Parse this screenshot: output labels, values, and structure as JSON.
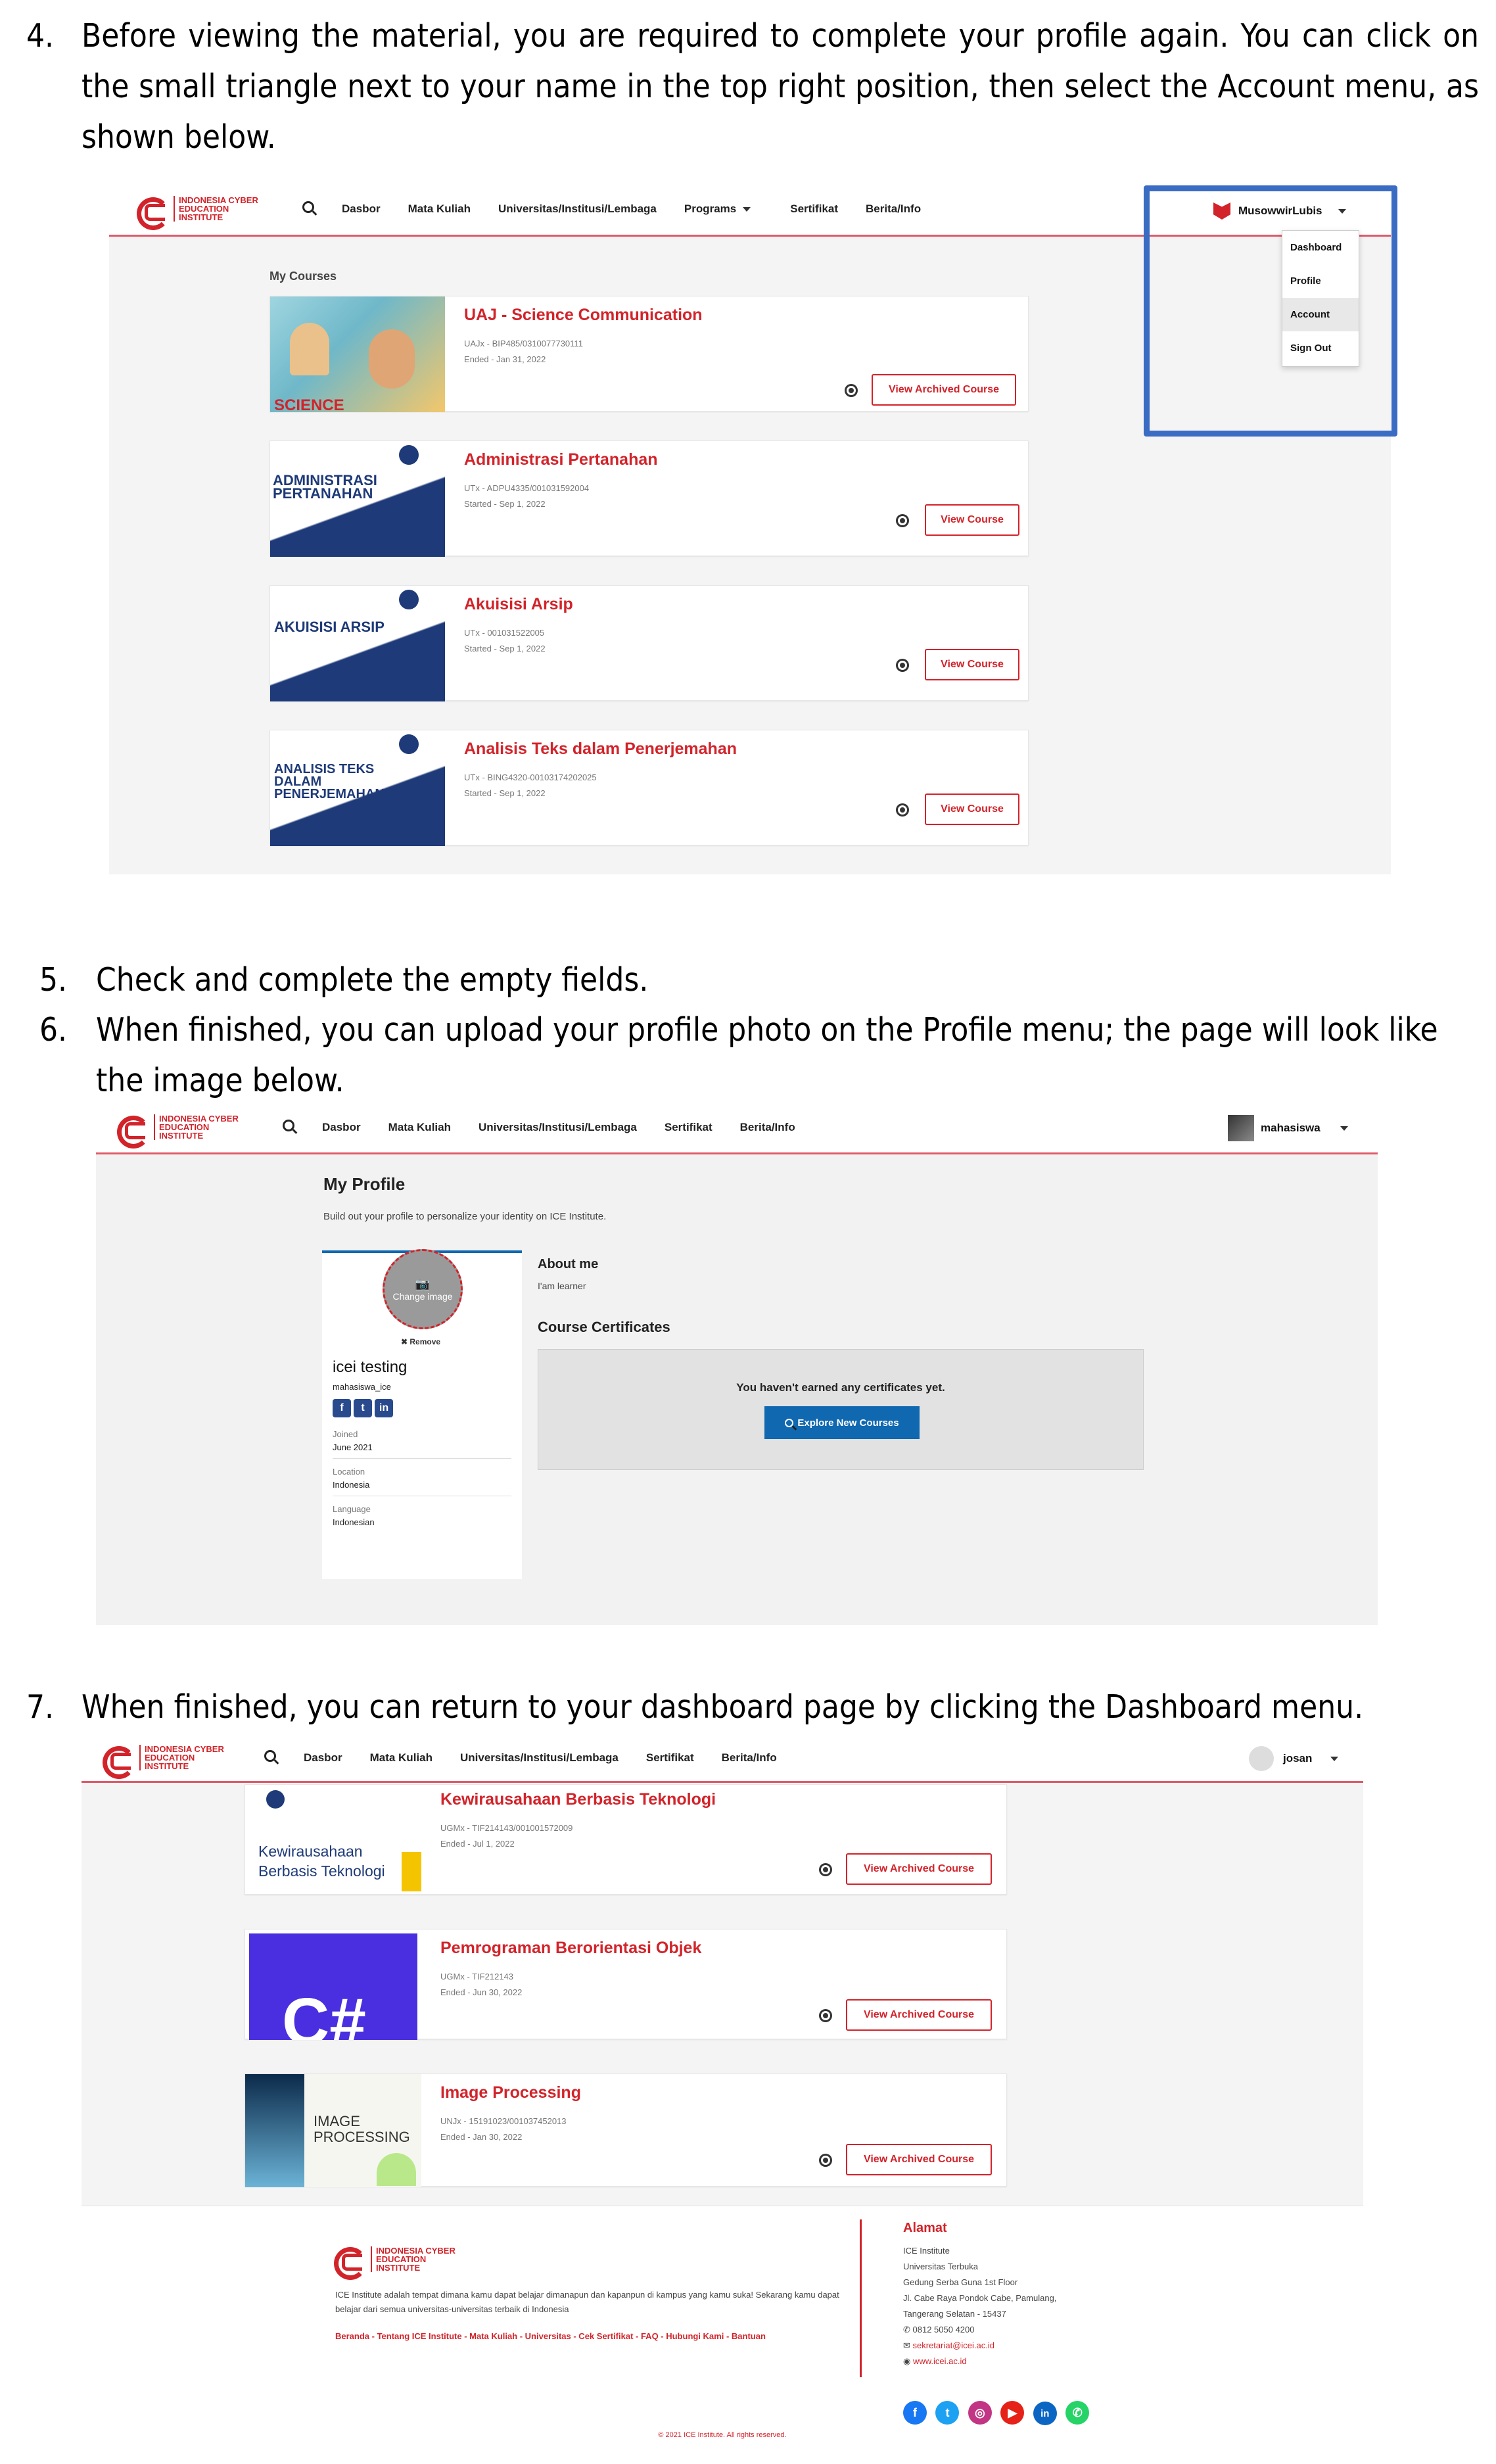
{
  "steps": {
    "s4": {
      "num": "4.",
      "text": "Before viewing the material, you are required to complete your profile again. You can click on the small triangle next to your name in the top right position, then select the Account menu, as shown below."
    },
    "s5": {
      "num": "5.",
      "text": "Check and complete the empty fields."
    },
    "s6": {
      "num": "6.",
      "text": "When finished, you can upload your profile photo on the Profile menu; the page will look like the image below."
    },
    "s7": {
      "num": "7.",
      "text": "When finished, you can return to your dashboard page by clicking the Dashboard menu."
    }
  },
  "brand": {
    "logo_text": "INDONESIA CYBER EDUCATION INSTITUTE",
    "accent": "#d2232a",
    "highlight": "#3b6cc4"
  },
  "shot1": {
    "nav": [
      "Dasbor",
      "Mata Kuliah",
      "Universitas/Institusi/Lembaga",
      "Programs",
      "Sertifikat",
      "Berita/Info"
    ],
    "user": "MusowwirLubis",
    "menu": [
      "Dashboard",
      "Profile",
      "Account",
      "Sign Out"
    ],
    "section_title": "My Courses",
    "courses": [
      {
        "title": "UAJ - Science Communication",
        "code": "UAJx - BIP485/0310077730111",
        "date": "Ended - Jan 31, 2022",
        "button": "View Archived Course",
        "thumb_text": "SCIENCE"
      },
      {
        "title": "Administrasi Pertanahan",
        "code": "UTx - ADPU4335/001031592004",
        "date": "Started - Sep 1, 2022",
        "button": "View Course",
        "thumb_text": "ADMINISTRASI PERTANAHAN"
      },
      {
        "title": "Akuisisi Arsip",
        "code": "UTx - 001031522005",
        "date": "Started - Sep 1, 2022",
        "button": "View Course",
        "thumb_text": "AKUISISI ARSIP"
      },
      {
        "title": "Analisis Teks dalam Penerjemahan",
        "code": "UTx - BING4320-00103174202025",
        "date": "Started - Sep 1, 2022",
        "button": "View Course",
        "thumb_text": "ANALISIS TEKS DALAM PENERJEMAHAN"
      }
    ]
  },
  "shot2": {
    "nav": [
      "Dasbor",
      "Mata Kuliah",
      "Universitas/Institusi/Lembaga",
      "Sertifikat",
      "Berita/Info"
    ],
    "user": "mahasiswa",
    "page_title": "My Profile",
    "subtitle": "Build out your profile to personalize your identity on ICE Institute.",
    "change_image": "Change image",
    "remove": "✖ Remove",
    "full_name": "icei testing",
    "username": "mahasiswa_ice",
    "joined_label": "Joined",
    "joined_value": "June 2021",
    "location_label": "Location",
    "location_value": "Indonesia",
    "language_label": "Language",
    "language_value": "Indonesian",
    "about_heading": "About me",
    "about_text": "I'am learner",
    "certs_heading": "Course Certificates",
    "no_certs": "You haven't earned any certificates yet.",
    "explore_button": "Explore New Courses"
  },
  "shot3": {
    "nav": [
      "Dasbor",
      "Mata Kuliah",
      "Universitas/Institusi/Lembaga",
      "Sertifikat",
      "Berita/Info"
    ],
    "user": "josan",
    "courses": [
      {
        "title": "Kewirausahaan Berbasis Teknologi",
        "code": "UGMx - TIF214143/001001572009",
        "date": "Ended - Jul 1, 2022",
        "button": "View Archived Course",
        "thumb_text": "Kewirausahaan Berbasis Teknologi"
      },
      {
        "title": "Pemrograman Berorientasi Objek",
        "code": "UGMx - TIF212143",
        "date": "Ended - Jun 30, 2022",
        "button": "View Archived Course",
        "thumb_text": "C#"
      },
      {
        "title": "Image Processing",
        "code": "UNJx - 15191023/001037452013",
        "date": "Ended - Jan 30, 2022",
        "button": "View Archived Course",
        "thumb_text": "IMAGE PROCESSING"
      }
    ],
    "footer": {
      "about": "ICE Institute adalah tempat dimana kamu dapat belajar dimanapun dan kapanpun di kampus yang kamu suka! Sekarang kamu dapat belajar dari semua universitas-universitas terbaik di Indonesia",
      "links": "Beranda - Tentang ICE Institute - Mata Kuliah - Universitas - Cek Sertifikat - FAQ - Hubungi Kami - Bantuan",
      "address_heading": "Alamat",
      "address_lines": [
        "ICE Institute",
        "Universitas Terbuka",
        "Gedung Serba Guna 1st Floor",
        "Jl. Cabe Raya Pondok Cabe, Pamulang,",
        "Tangerang Selatan - 15437"
      ],
      "phone": "0812 5050 4200",
      "email": "sekretariat@icei.ac.id",
      "web": "www.icei.ac.id",
      "copyright": "© 2021 ICE Institute. All rights reserved."
    }
  }
}
